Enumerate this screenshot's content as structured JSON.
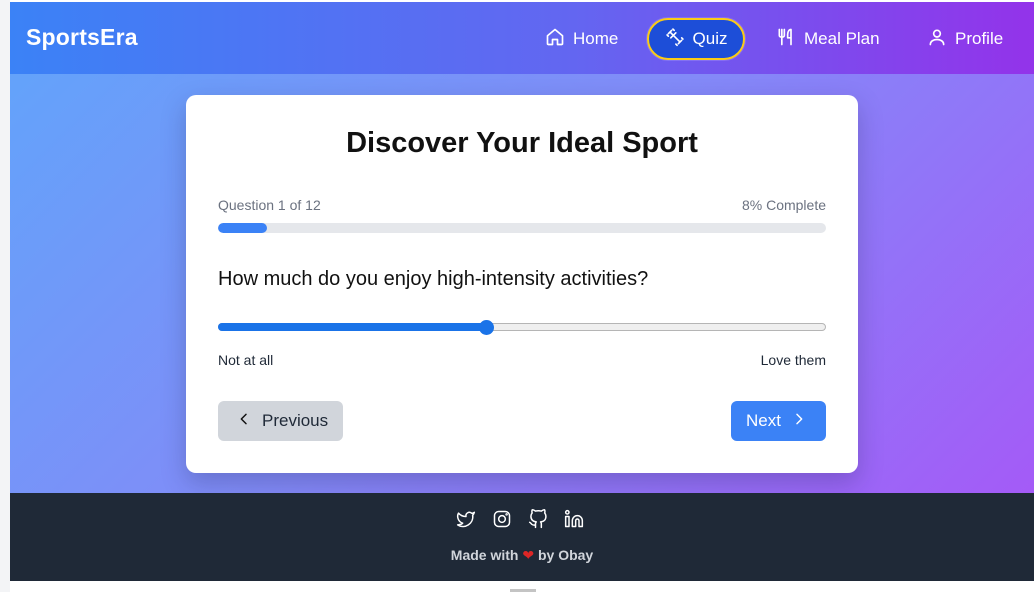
{
  "navbar": {
    "brand": "SportsEra",
    "items": [
      {
        "label": "Home",
        "icon": "home-icon"
      },
      {
        "label": "Quiz",
        "icon": "dumbbell-icon",
        "active": true
      },
      {
        "label": "Meal Plan",
        "icon": "utensils-icon"
      },
      {
        "label": "Profile",
        "icon": "user-icon"
      }
    ]
  },
  "quiz": {
    "title": "Discover Your Ideal Sport",
    "progress_label": "Question 1 of 12",
    "progress_percent_label": "8% Complete",
    "progress_fraction": 0.08,
    "question": "How much do you enjoy high-intensity activities?",
    "slider_fraction": 0.44,
    "scale_min_label": "Not at all",
    "scale_max_label": "Love them",
    "previous_label": "Previous",
    "next_label": "Next"
  },
  "footer": {
    "social": [
      "twitter-icon",
      "instagram-icon",
      "github-icon",
      "linkedin-icon"
    ],
    "made_with": "Made with",
    "by": "by Obay"
  },
  "colors": {
    "accent": "#3b82f6",
    "footer_bg": "#1f2937",
    "active_border": "#facc15"
  }
}
